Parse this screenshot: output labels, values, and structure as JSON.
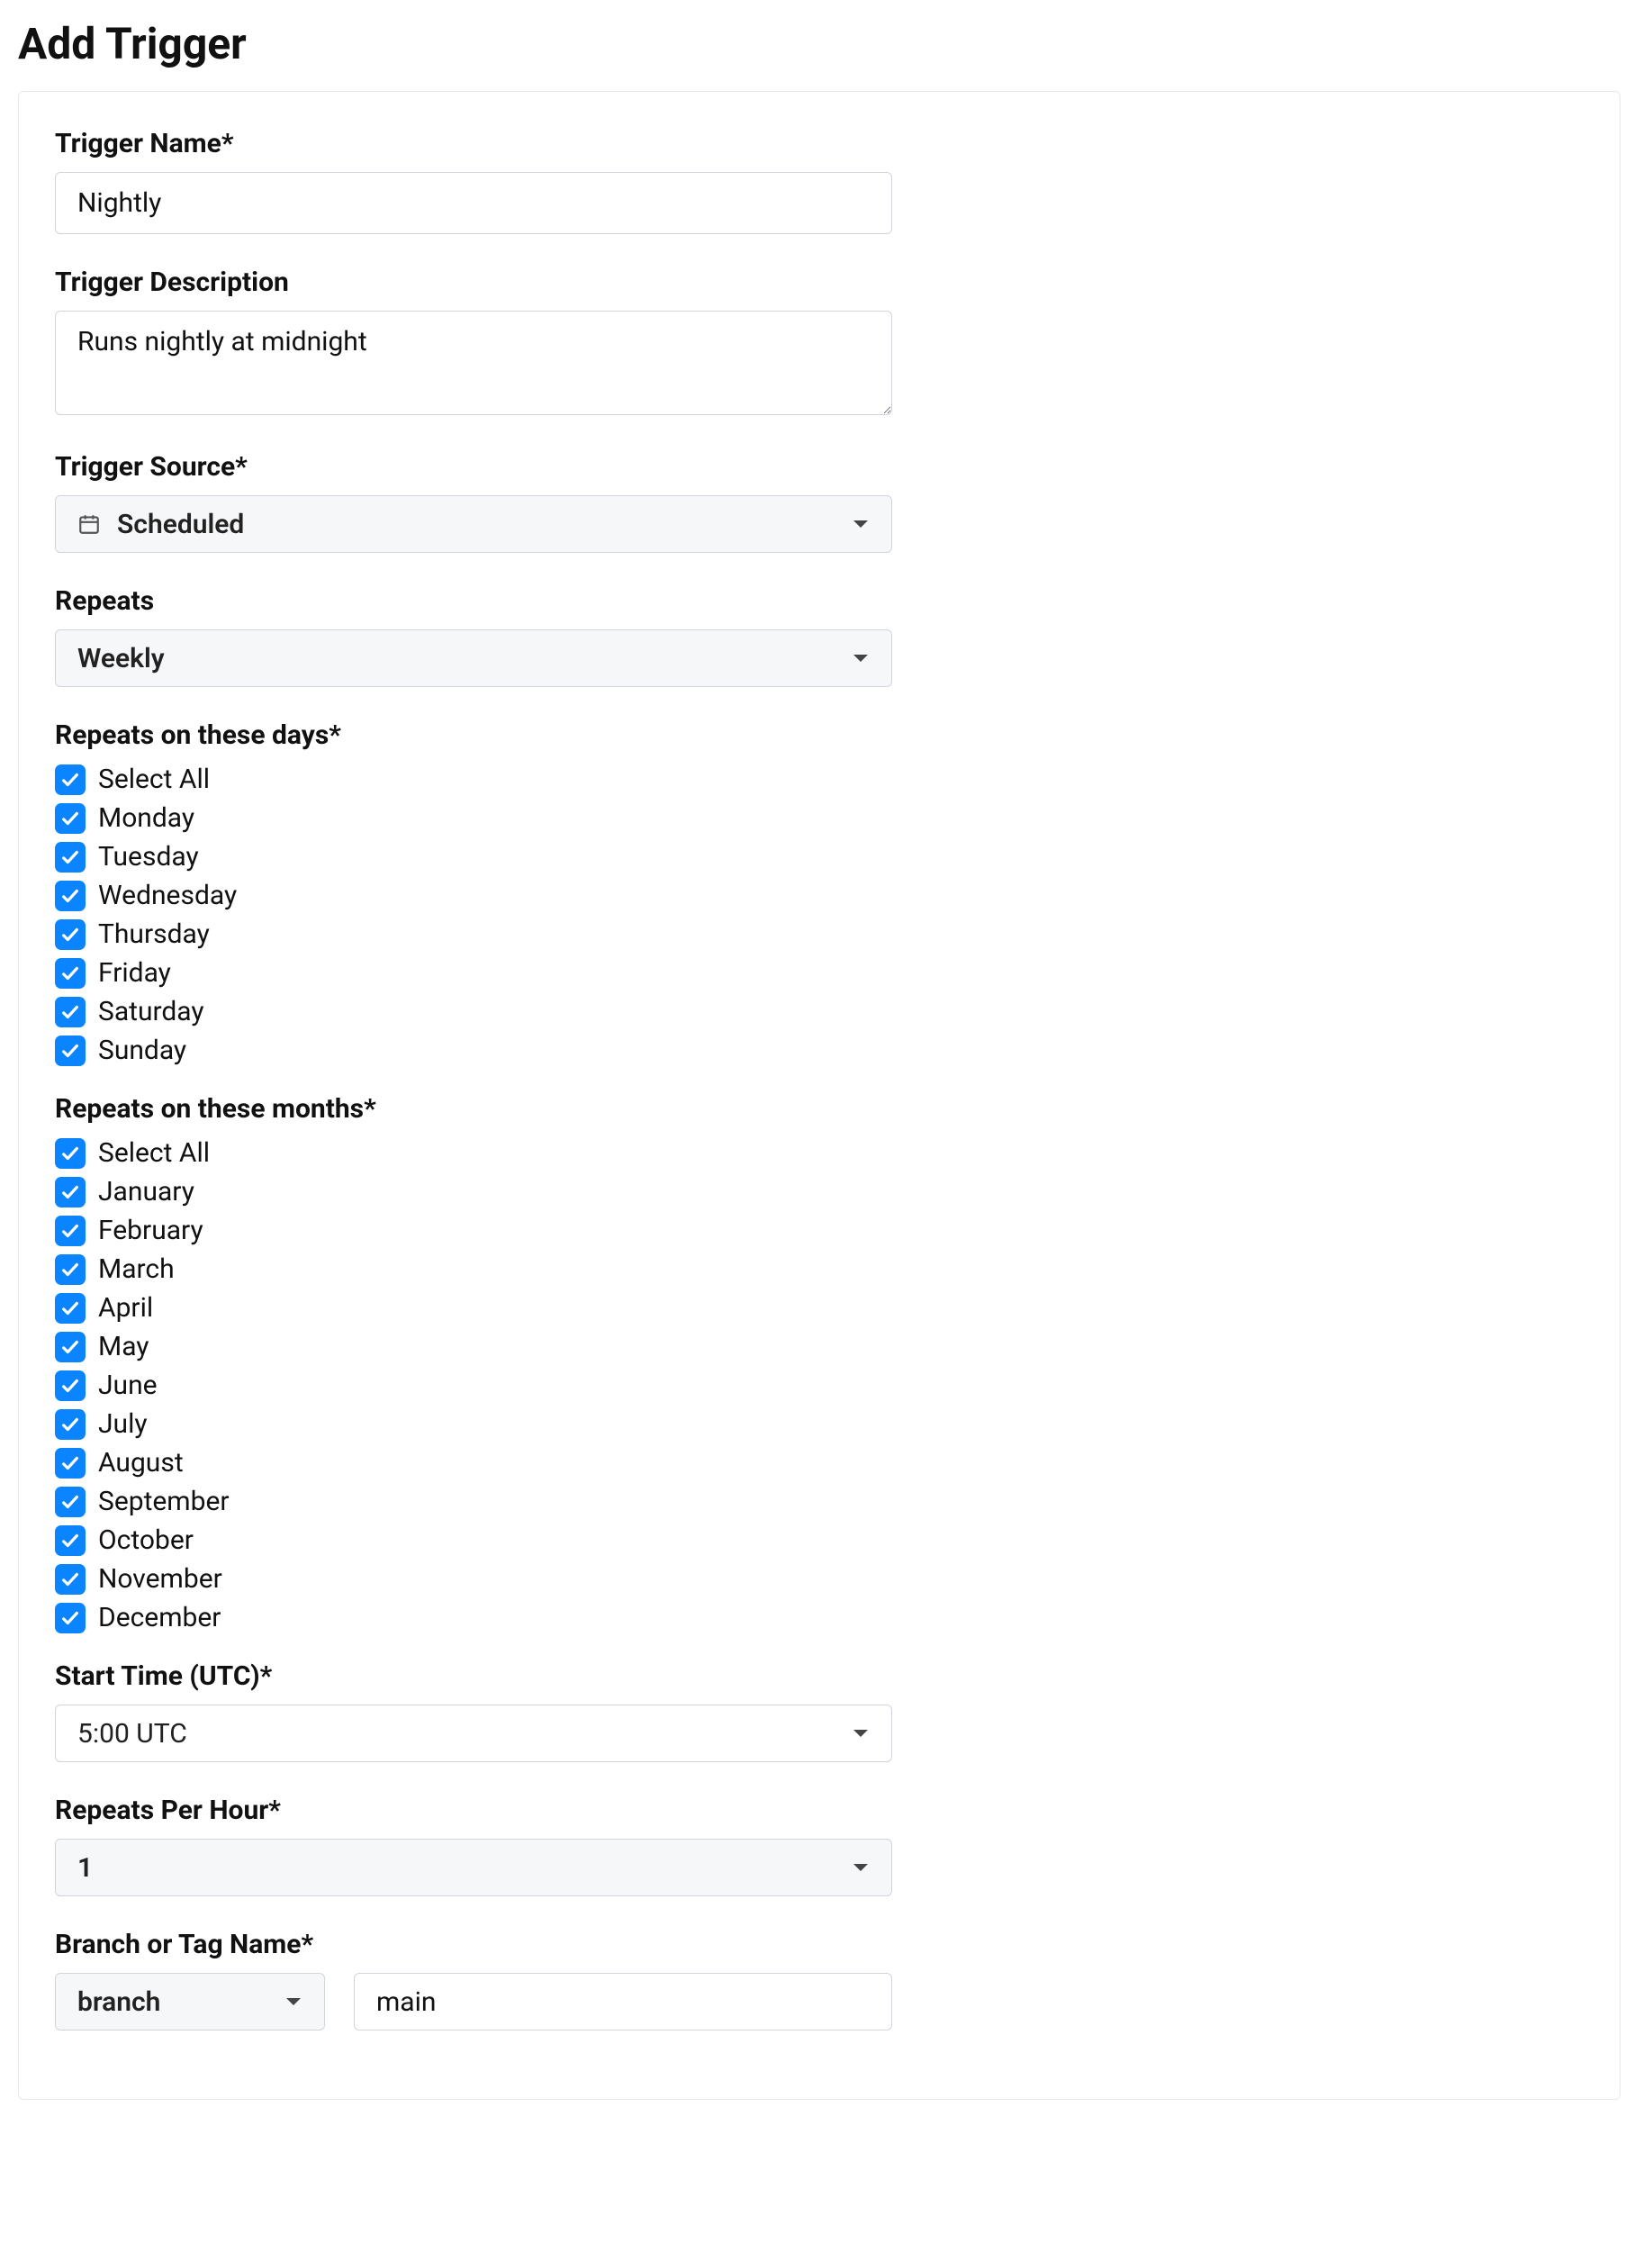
{
  "pageTitle": "Add Trigger",
  "form": {
    "triggerName": {
      "label": "Trigger Name*",
      "value": "Nightly"
    },
    "triggerDescription": {
      "label": "Trigger Description",
      "value": "Runs nightly at midnight"
    },
    "triggerSource": {
      "label": "Trigger Source*",
      "value": "Scheduled",
      "icon": "calendar-icon"
    },
    "repeats": {
      "label": "Repeats",
      "value": "Weekly"
    },
    "repeatsDays": {
      "label": "Repeats on these days*",
      "items": [
        {
          "label": "Select All",
          "checked": true
        },
        {
          "label": "Monday",
          "checked": true
        },
        {
          "label": "Tuesday",
          "checked": true
        },
        {
          "label": "Wednesday",
          "checked": true
        },
        {
          "label": "Thursday",
          "checked": true
        },
        {
          "label": "Friday",
          "checked": true
        },
        {
          "label": "Saturday",
          "checked": true
        },
        {
          "label": "Sunday",
          "checked": true
        }
      ]
    },
    "repeatsMonths": {
      "label": "Repeats on these months*",
      "items": [
        {
          "label": "Select All",
          "checked": true
        },
        {
          "label": "January",
          "checked": true
        },
        {
          "label": "February",
          "checked": true
        },
        {
          "label": "March",
          "checked": true
        },
        {
          "label": "April",
          "checked": true
        },
        {
          "label": "May",
          "checked": true
        },
        {
          "label": "June",
          "checked": true
        },
        {
          "label": "July",
          "checked": true
        },
        {
          "label": "August",
          "checked": true
        },
        {
          "label": "September",
          "checked": true
        },
        {
          "label": "October",
          "checked": true
        },
        {
          "label": "November",
          "checked": true
        },
        {
          "label": "December",
          "checked": true
        }
      ]
    },
    "startTime": {
      "label": "Start Time (UTC)*",
      "value": "5:00 UTC"
    },
    "repeatsPerHour": {
      "label": "Repeats Per Hour*",
      "value": "1"
    },
    "branchOrTag": {
      "label": "Branch or Tag Name*",
      "type": "branch",
      "value": "main"
    }
  }
}
